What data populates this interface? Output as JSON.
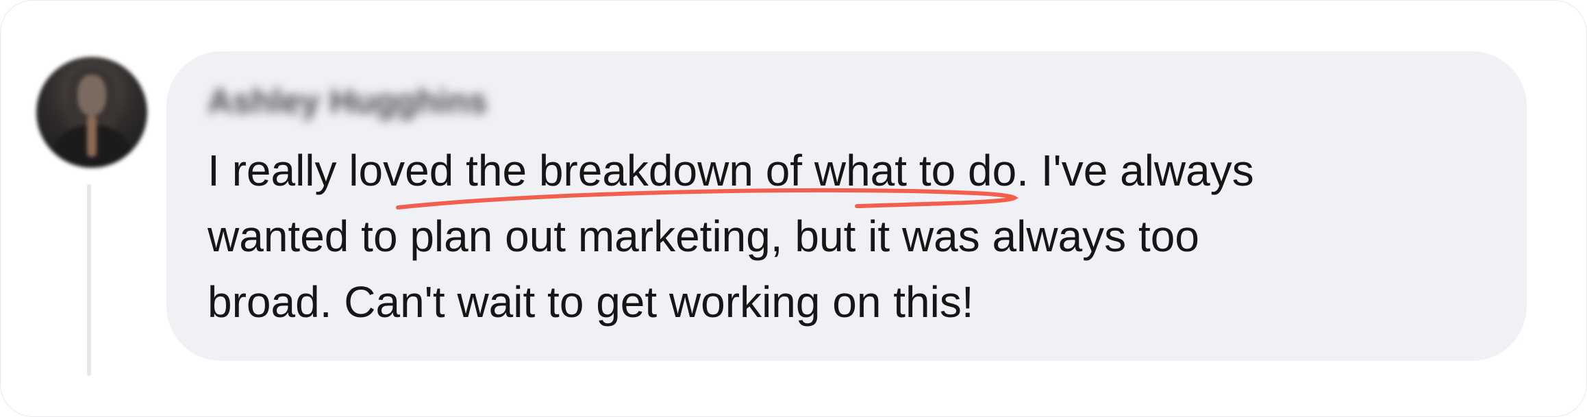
{
  "comment": {
    "author_name": "Ashley Hugghins",
    "text_lines": [
      "I really loved the breakdown of what to do. I've always",
      "wanted to plan out marketing, but it was always too",
      "broad. Can't wait to get working on this!"
    ],
    "avatar_icon": "profile-photo",
    "highlight": {
      "type": "underline",
      "color": "#f0604d",
      "covers_text": "loved the breakdown of what"
    }
  },
  "colors": {
    "bubble_background": "#f0f1f5",
    "text": "#161616",
    "thread_line": "#e6e6ea"
  }
}
